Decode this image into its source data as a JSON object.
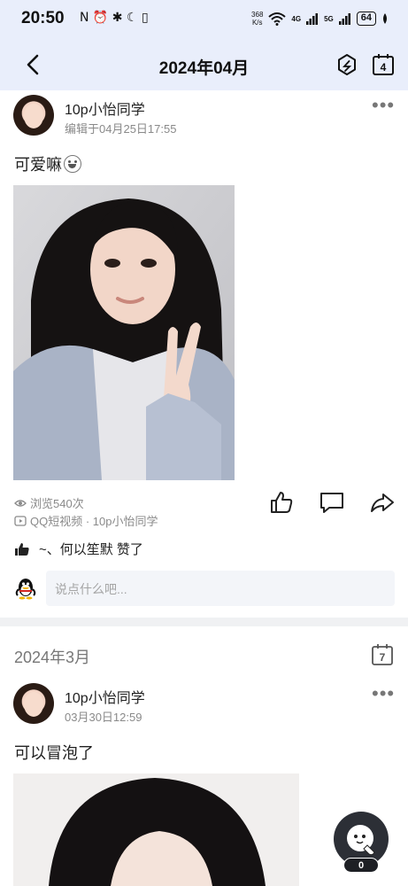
{
  "status_bar": {
    "time": "20:50",
    "left_icons": "N ⏰ ✱ ☾ ▯",
    "net_speed_value": "368",
    "net_speed_unit": "K/s",
    "signal_1": "4G",
    "signal_2": "5G",
    "battery": "64"
  },
  "nav": {
    "title": "2024年04月",
    "calendar_day": "4"
  },
  "post1": {
    "username": "10p小怡同学",
    "time": "编辑于04月25日17:55",
    "text": "可爱嘛",
    "views": "浏览540次",
    "source": "QQ短视频 · 10p小怡同学",
    "likes": "~、何以笙默 赞了",
    "comment_placeholder": "说点什么吧..."
  },
  "section": {
    "month": "2024年3月",
    "calendar_day": "7"
  },
  "post2": {
    "username": "10p小怡同学",
    "time": "03月30日12:59",
    "text": "可以冒泡了"
  },
  "floating": {
    "badge": "0"
  },
  "colors": {
    "header_bg": "#e9eefb",
    "secondary_text": "#8a8a8a",
    "divider": "#f0f1f3",
    "input_bg": "#f3f5f9"
  }
}
